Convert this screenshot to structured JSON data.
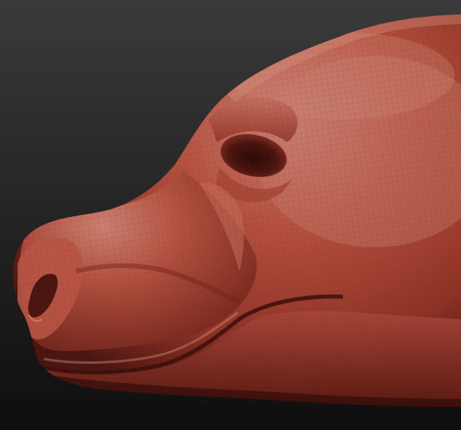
{
  "viewport": {
    "background_colors": {
      "top": "#3a3a3a",
      "bottom": "#0e0e0e"
    },
    "model": {
      "subject": "animal-head-sculpt",
      "material_colors": {
        "base": "#9b3a2e",
        "highlight": "#d08878",
        "midtone": "#b4503f",
        "shadow": "#4a1510",
        "deep_shadow": "#2a0806"
      },
      "wireframe_visible": true,
      "wireframe_color": "#7a2a20"
    }
  }
}
